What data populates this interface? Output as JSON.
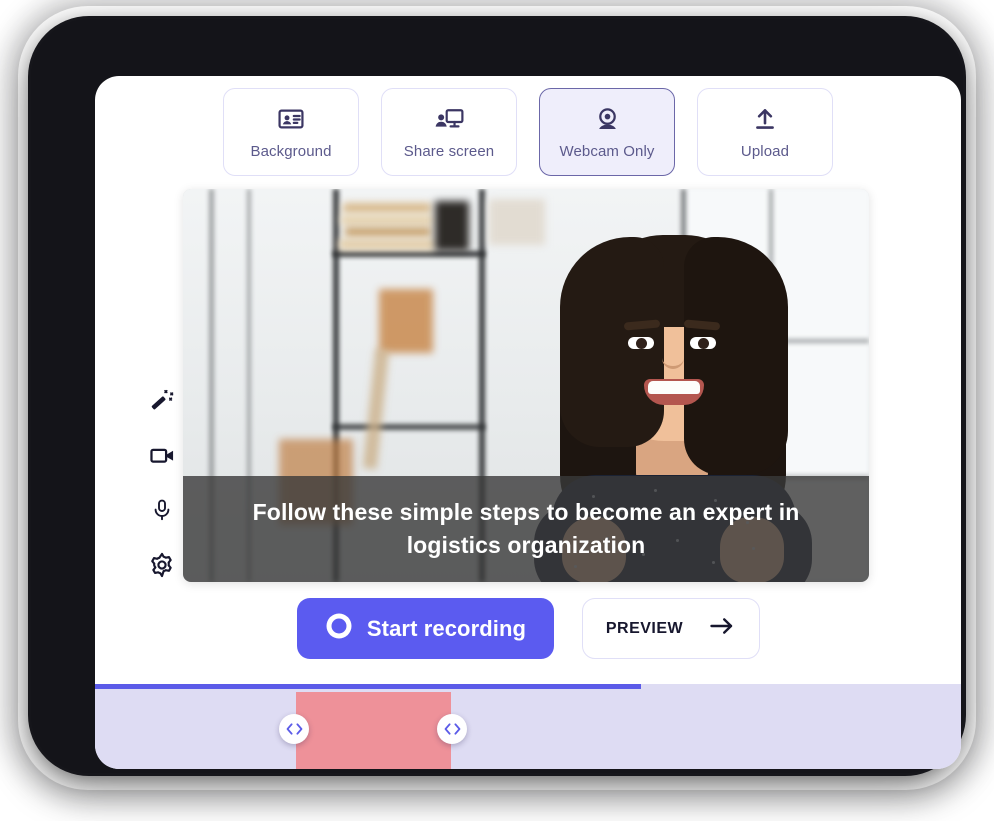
{
  "app": {
    "modes": [
      {
        "label": "Background",
        "icon": "id-card-icon",
        "selected": false
      },
      {
        "label": "Share screen",
        "icon": "share-screen-icon",
        "selected": false
      },
      {
        "label": "Webcam Only",
        "icon": "webcam-icon",
        "selected": true
      },
      {
        "label": "Upload",
        "icon": "upload-icon",
        "selected": false
      }
    ],
    "tools": [
      {
        "name": "magic-wand-icon"
      },
      {
        "name": "video-camera-icon"
      },
      {
        "name": "microphone-icon"
      },
      {
        "name": "settings-gear-icon"
      }
    ],
    "video": {
      "caption": "Follow these simple steps to become an expert in logistics organization"
    },
    "actions": {
      "record_label": "Start recording",
      "record_icon": "record-circle-icon",
      "preview_label": "PREVIEW",
      "preview_icon": "arrow-right-icon"
    },
    "timeline": {
      "progress_percent": 63,
      "clip_label": "",
      "handle_icon": "trim-chevrons-icon"
    },
    "colors": {
      "accent": "#5B5BF0",
      "accent_progress": "#5B5BE8",
      "selected_fill": "#EFEEFB",
      "selected_border": "#6B67A8",
      "button_border": "#E0DFF7",
      "label_text": "#5C5A8C",
      "dark_text": "#17172E",
      "timeline_bg": "#DEDCF3",
      "clip": "#EE9199",
      "bezel": "#141419",
      "caption_bg": "rgba(58,58,58,0.80)"
    }
  }
}
